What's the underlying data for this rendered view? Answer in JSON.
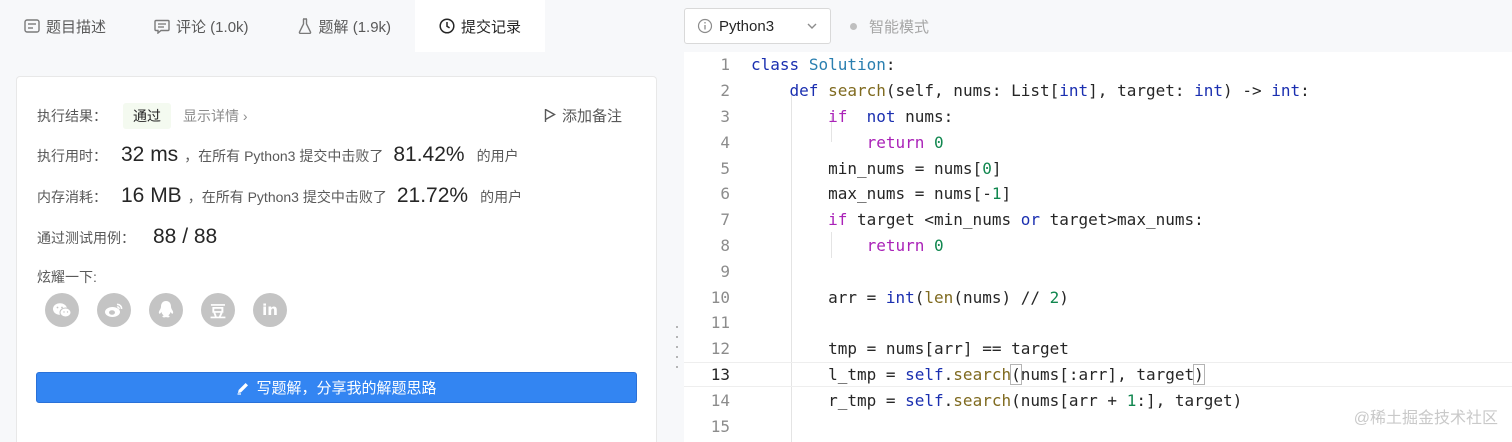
{
  "tabs": [
    {
      "label": "题目描述",
      "icon": "document-icon"
    },
    {
      "label": "评论 (1.0k)",
      "icon": "comment-icon"
    },
    {
      "label": "题解 (1.9k)",
      "icon": "flask-icon"
    },
    {
      "label": "提交记录",
      "icon": "clock-icon"
    }
  ],
  "result": {
    "label": "执行结果：",
    "status": "通过",
    "detail": "显示详情 ›",
    "note": "添加备注"
  },
  "time": {
    "label": "执行用时：",
    "value": "32 ms",
    "desc": "，在所有 Python3 提交中击败了",
    "pct": "81.42%",
    "suffix": "的用户"
  },
  "memory": {
    "label": "内存消耗：",
    "value": "16 MB",
    "desc": "，在所有 Python3 提交中击败了",
    "pct": "21.72%",
    "suffix": "的用户"
  },
  "tests": {
    "label": "通过测试用例：",
    "value": "88 / 88"
  },
  "share": {
    "label": "炫耀一下:",
    "icons": [
      "wechat-icon",
      "weibo-icon",
      "qq-icon",
      "douban-icon",
      "linkedin-icon"
    ],
    "douban_glyph": "豆",
    "linkedin_glyph": "in"
  },
  "write_button": "写题解，分享我的解题思路",
  "editor": {
    "language": "Python3",
    "smart_mode": "智能模式",
    "current_line": 13
  },
  "watermark": "@稀土掘金技术社区"
}
